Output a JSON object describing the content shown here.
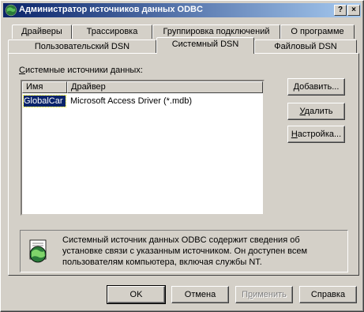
{
  "window": {
    "title": "Администратор источников данных ODBC",
    "help_button": "?",
    "close_button": "×"
  },
  "tabs_row1": [
    "Драйверы",
    "Трассировка",
    "Группировка подключений",
    "О программе"
  ],
  "tabs_row2": [
    "Пользовательский DSN",
    "Системный DSN",
    "Файловый DSN"
  ],
  "active_tab": "Системный DSN",
  "group_label": "Системные источники данных:",
  "list": {
    "columns": [
      "Имя",
      "Драйвер"
    ],
    "rows": [
      {
        "name": "GlobalCar",
        "driver": "Microsoft Access Driver (*.mdb)"
      }
    ]
  },
  "side_buttons": {
    "add": "Добавить...",
    "remove": "Удалить",
    "configure": "Настройка..."
  },
  "info_text": "Системный источник данных ODBC содержит сведения об установке связи с указанным источником. Он доступен всем пользователям компьютера, включая службы NT.",
  "bottom_buttons": {
    "ok": "OK",
    "cancel": "Отмена",
    "apply": "Применить",
    "help": "Справка"
  },
  "colors": {
    "face": "#d4d0c8",
    "title_start": "#0a246a",
    "title_end": "#a6caf0",
    "selection": "#0a246a"
  }
}
